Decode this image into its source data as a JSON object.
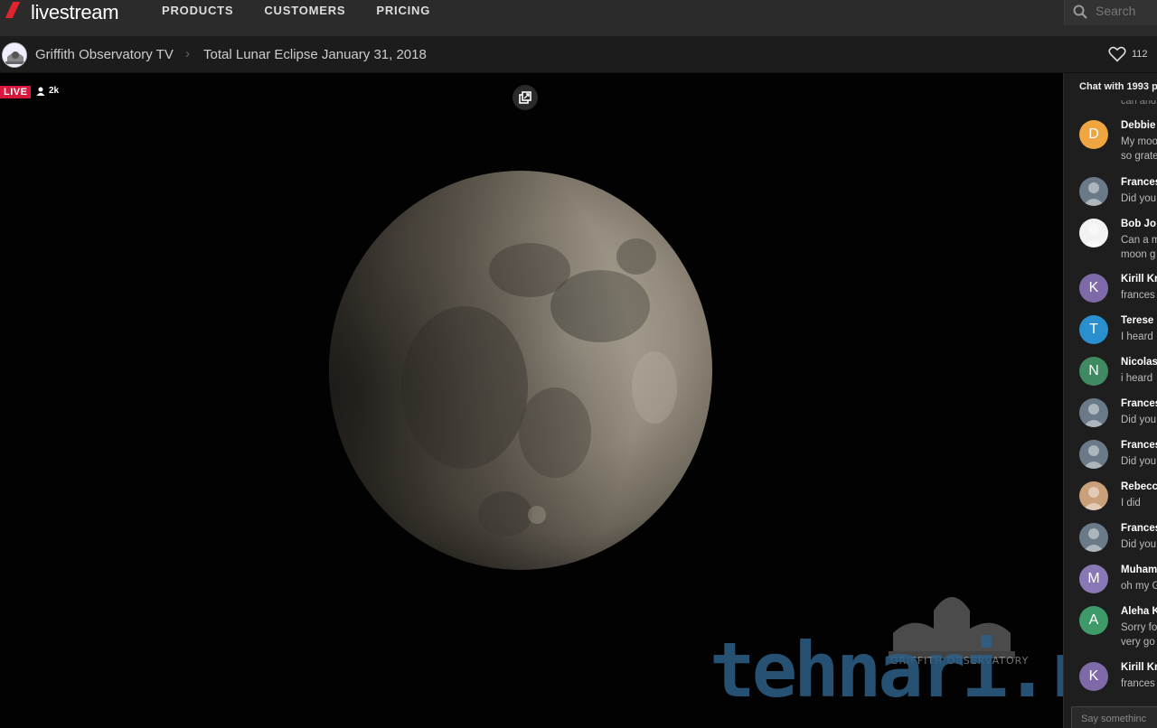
{
  "brand": {
    "name": "livestream"
  },
  "nav": {
    "items": [
      "PRODUCTS",
      "CUSTOMERS",
      "PRICING"
    ]
  },
  "search": {
    "placeholder": "Search"
  },
  "breadcrumb": {
    "channel": "Griffith Observatory TV",
    "separator": "›",
    "event": "Total Lunar Eclipse January 31, 2018"
  },
  "likes": {
    "count": "112"
  },
  "video": {
    "live_label": "LIVE",
    "viewers": "2k",
    "watermark": "tehnari.ru",
    "watermark_caption": "GRIFFITH OBSERVATORY"
  },
  "chat": {
    "header": "Chat with 1993 p",
    "cutoff_text": "can and",
    "input_placeholder": "Say somethinc",
    "messages": [
      {
        "initial": "D",
        "color": "#f0a640",
        "name": "Debbie",
        "lines": [
          "My moo",
          "so grate"
        ]
      },
      {
        "initial": "",
        "color": "#6b7a88",
        "name": "Frances",
        "lines": [
          "Did you"
        ]
      },
      {
        "initial": "",
        "color": "#f2f2f2",
        "name": "Bob Jo",
        "lines": [
          "Can a m",
          "moon g"
        ]
      },
      {
        "initial": "K",
        "color": "#7e6aa8",
        "name": "Kirill Kr",
        "lines": [
          "frances"
        ]
      },
      {
        "initial": "T",
        "color": "#2a8fcf",
        "name": "Terese",
        "lines": [
          "I heard"
        ]
      },
      {
        "initial": "N",
        "color": "#3f8a62",
        "name": "Nicolas",
        "lines": [
          "i heard"
        ]
      },
      {
        "initial": "",
        "color": "#6b7a88",
        "name": "Frances",
        "lines": [
          "Did you"
        ]
      },
      {
        "initial": "",
        "color": "#6b7a88",
        "name": "Frances",
        "lines": [
          "Did you"
        ]
      },
      {
        "initial": "",
        "color": "#c9a07a",
        "name": "Rebecc",
        "lines": [
          "I did"
        ]
      },
      {
        "initial": "",
        "color": "#6b7a88",
        "name": "Frances",
        "lines": [
          "Did you"
        ]
      },
      {
        "initial": "M",
        "color": "#8a77b5",
        "name": "Muham",
        "lines": [
          "oh my G"
        ]
      },
      {
        "initial": "A",
        "color": "#3f9a6a",
        "name": "Aleha K",
        "lines": [
          "Sorry fo",
          "very go"
        ]
      },
      {
        "initial": "K",
        "color": "#7e6aa8",
        "name": "Kirill Kr",
        "lines": [
          "frances"
        ]
      }
    ]
  }
}
